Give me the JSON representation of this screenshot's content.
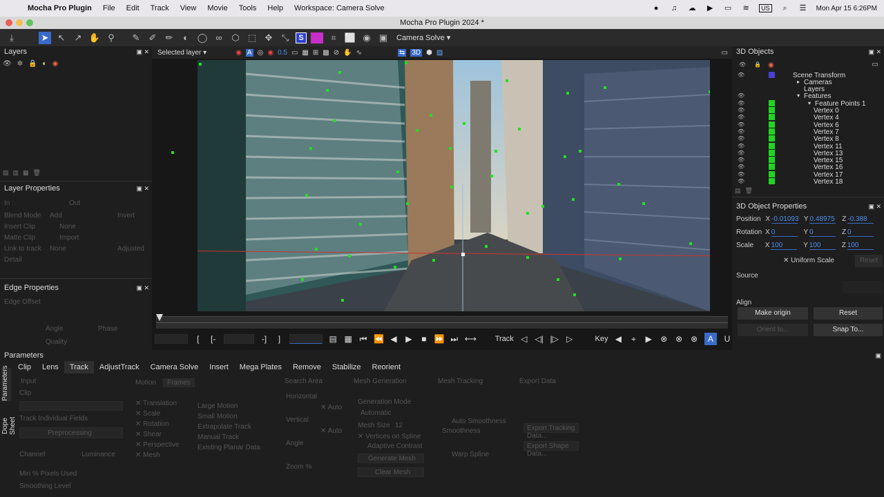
{
  "menubar": {
    "app": "Mocha Pro Plugin",
    "items": [
      "File",
      "Edit",
      "Track",
      "View",
      "Movie",
      "Tools",
      "Help",
      "Workspace: Camera Solve"
    ],
    "clock": "Mon Apr 15  6:26PM",
    "input_badge": "US"
  },
  "window": {
    "title": "Mocha Pro Plugin 2024 *"
  },
  "toolbar": {
    "camera_mode": "Camera Solve"
  },
  "viewer_bar": {
    "layer_select": "Selected layer",
    "opacity": "0.5",
    "badge_3d": "3D"
  },
  "panels": {
    "layers": "Layers",
    "layer_properties": "Layer Properties",
    "edge_properties": "Edge Properties",
    "objects_3d": "3D Objects",
    "object_properties_3d": "3D Object Properties",
    "parameters": "Parameters"
  },
  "layer_properties": {
    "in": "In",
    "out": "Out",
    "blend_mode": "Blend Mode",
    "blend_value": "Add",
    "invert": "Invert",
    "insert_clip": "Insert Clip",
    "insert_value": "None",
    "matte_clip": "Matte Clip",
    "matte_value": "Import",
    "link_to_track": "Link to track",
    "link_value": "None",
    "adjusted": "Adjusted",
    "detail": "Detail"
  },
  "edge_properties": {
    "edge_offset": "Edge Offset",
    "angle": "Angle",
    "phase": "Phase",
    "quality": "Quality"
  },
  "tree": {
    "scene": "Scene Transform",
    "cameras": "Cameras",
    "layers": "Layers",
    "features": "Features",
    "fp": "Feature Points 1",
    "vertices": [
      "Vertex 0",
      "Vertex 4",
      "Vertex 6",
      "Vertex 7",
      "Vertex 8",
      "Vertex 11",
      "Vertex 13",
      "Vertex 15",
      "Vertex 16",
      "Vertex 17",
      "Vertex 18"
    ]
  },
  "obj_props": {
    "position_label": "Position",
    "rotation_label": "Rotation",
    "scale_label": "Scale",
    "x": "X",
    "y": "Y",
    "z": "Z",
    "pos": [
      "-0.01093",
      "0.48975",
      "-0.388"
    ],
    "rot": [
      "0",
      "0",
      "0"
    ],
    "scale": [
      "100",
      "100",
      "100"
    ],
    "uniform": "Uniform Scale",
    "reset_small": "Reset",
    "source": "Source",
    "align": "Align",
    "make_origin": "Make origin",
    "reset": "Reset",
    "orient": "Orient to...",
    "snap": "Snap To..."
  },
  "transport": {
    "track_label": "Track",
    "key_label": "Key"
  },
  "params": {
    "tabs": [
      "Clip",
      "Lens",
      "Track",
      "AdjustTrack",
      "Camera Solve",
      "Insert",
      "Mega Plates",
      "Remove",
      "Stabilize",
      "Reorient"
    ],
    "active_tab": "Track",
    "side_tabs": [
      "Parameters",
      "Dope Sheet"
    ],
    "sections": [
      "Input",
      "Motion",
      "Frames",
      "Search Area",
      "Mesh Generation",
      "Mesh Tracking",
      "Export Data"
    ],
    "input": {
      "clip": "Clip",
      "track_fields": "Track Individual Fields",
      "preprocessing": "Preprocessing",
      "channel": "Channel",
      "channel_value": "Luminance",
      "min_pixels": "Min % Pixels Used",
      "smoothing": "Smoothing Level"
    },
    "motion": [
      "Translation",
      "Scale",
      "Rotation",
      "Shear",
      "Perspective",
      "Mesh"
    ],
    "motion2": [
      "Large Motion",
      "Small Motion",
      "Extrapolate Track",
      "Manual Track",
      "Existing Planar Data"
    ],
    "search": {
      "horizontal": "Horizontal",
      "vertical": "Vertical",
      "angle": "Angle",
      "zoom": "Zoom %",
      "auto": "Auto"
    },
    "mesh_gen": {
      "mode": "Generation Mode",
      "mode_value": "Automatic",
      "mesh_size": "Mesh Size",
      "mesh_size_value": "12",
      "vertices_on_spline": "Vertices on Spline",
      "adaptive_contrast": "Adaptive Contrast",
      "generate": "Generate Mesh",
      "clear": "Clear Mesh"
    },
    "mesh_track": {
      "auto_smooth": "Auto Smoothness",
      "smoothness": "Smoothness",
      "warp_spline": "Warp Spline"
    },
    "export": {
      "export_tracking": "Export Tracking Data...",
      "export_shape": "Export Shape Data..."
    }
  }
}
